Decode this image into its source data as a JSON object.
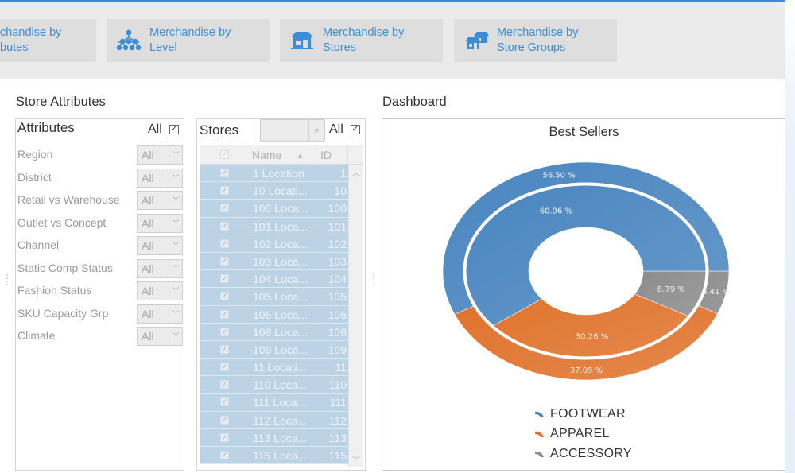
{
  "toolbar": {
    "buttons": [
      {
        "label": "chandise by\nbutes",
        "icon": "attributes-icon"
      },
      {
        "label": "Merchandise by\nLevel",
        "icon": "hierarchy-icon"
      },
      {
        "label": "Merchandise by\nStores",
        "icon": "store-icon"
      },
      {
        "label": "Merchandise by\nStore Groups",
        "icon": "store-groups-icon"
      }
    ]
  },
  "store_attributes": {
    "title": "Store Attributes",
    "header": "Attributes",
    "all_label": "All",
    "all_checked": true,
    "rows": [
      {
        "name": "Region",
        "value": "All"
      },
      {
        "name": "District",
        "value": "All"
      },
      {
        "name": "Retail vs Warehouse",
        "value": "All"
      },
      {
        "name": "Outlet vs Concept",
        "value": "All"
      },
      {
        "name": "Channel",
        "value": "All"
      },
      {
        "name": "Static Comp Status",
        "value": "All"
      },
      {
        "name": "Fashion Status",
        "value": "All"
      },
      {
        "name": "SKU Capacity Grp",
        "value": "All"
      },
      {
        "name": "Climate",
        "value": "All"
      }
    ]
  },
  "stores": {
    "header": "Stores",
    "search_value": "",
    "all_label": "All",
    "all_checked": true,
    "columns": [
      "Name",
      "ID"
    ],
    "sort_indicator": "▲",
    "rows": [
      {
        "name": "1 Location",
        "id": "1"
      },
      {
        "name": "10 Locati...",
        "id": "10"
      },
      {
        "name": "100 Loca...",
        "id": "100"
      },
      {
        "name": "101 Loca...",
        "id": "101"
      },
      {
        "name": "102 Loca...",
        "id": "102"
      },
      {
        "name": "103 Loca...",
        "id": "103"
      },
      {
        "name": "104 Loca...",
        "id": "104"
      },
      {
        "name": "105 Loca...",
        "id": "105"
      },
      {
        "name": "106 Loca...",
        "id": "106"
      },
      {
        "name": "108 Loca...",
        "id": "108"
      },
      {
        "name": "109 Loca...",
        "id": "109"
      },
      {
        "name": "11 Locati...",
        "id": "11"
      },
      {
        "name": "110 Loca...",
        "id": "110"
      },
      {
        "name": "111 Loca...",
        "id": "111"
      },
      {
        "name": "112 Loca...",
        "id": "112"
      },
      {
        "name": "113 Loca...",
        "id": "113"
      },
      {
        "name": "115 Loca...",
        "id": "115"
      }
    ]
  },
  "dashboard": {
    "title": "Dashboard"
  },
  "chart_data": {
    "type": "pie",
    "subtype": "nested-donut",
    "title": "Best Sellers",
    "categories": [
      "FOOTWEAR",
      "APPAREL",
      "ACCESSORY"
    ],
    "colors": [
      "#4a86c0",
      "#e0732c",
      "#8c8c8c"
    ],
    "series": [
      {
        "name": "outer",
        "values": [
          56.5,
          37.09,
          6.41
        ],
        "labels": [
          "56.50 %",
          "37.09 %",
          "6.41 %"
        ]
      },
      {
        "name": "inner",
        "values": [
          60.96,
          30.26,
          8.79
        ],
        "labels": [
          "60.96 %",
          "30.26 %",
          "8.79 %"
        ]
      }
    ],
    "legend_position": "bottom"
  }
}
